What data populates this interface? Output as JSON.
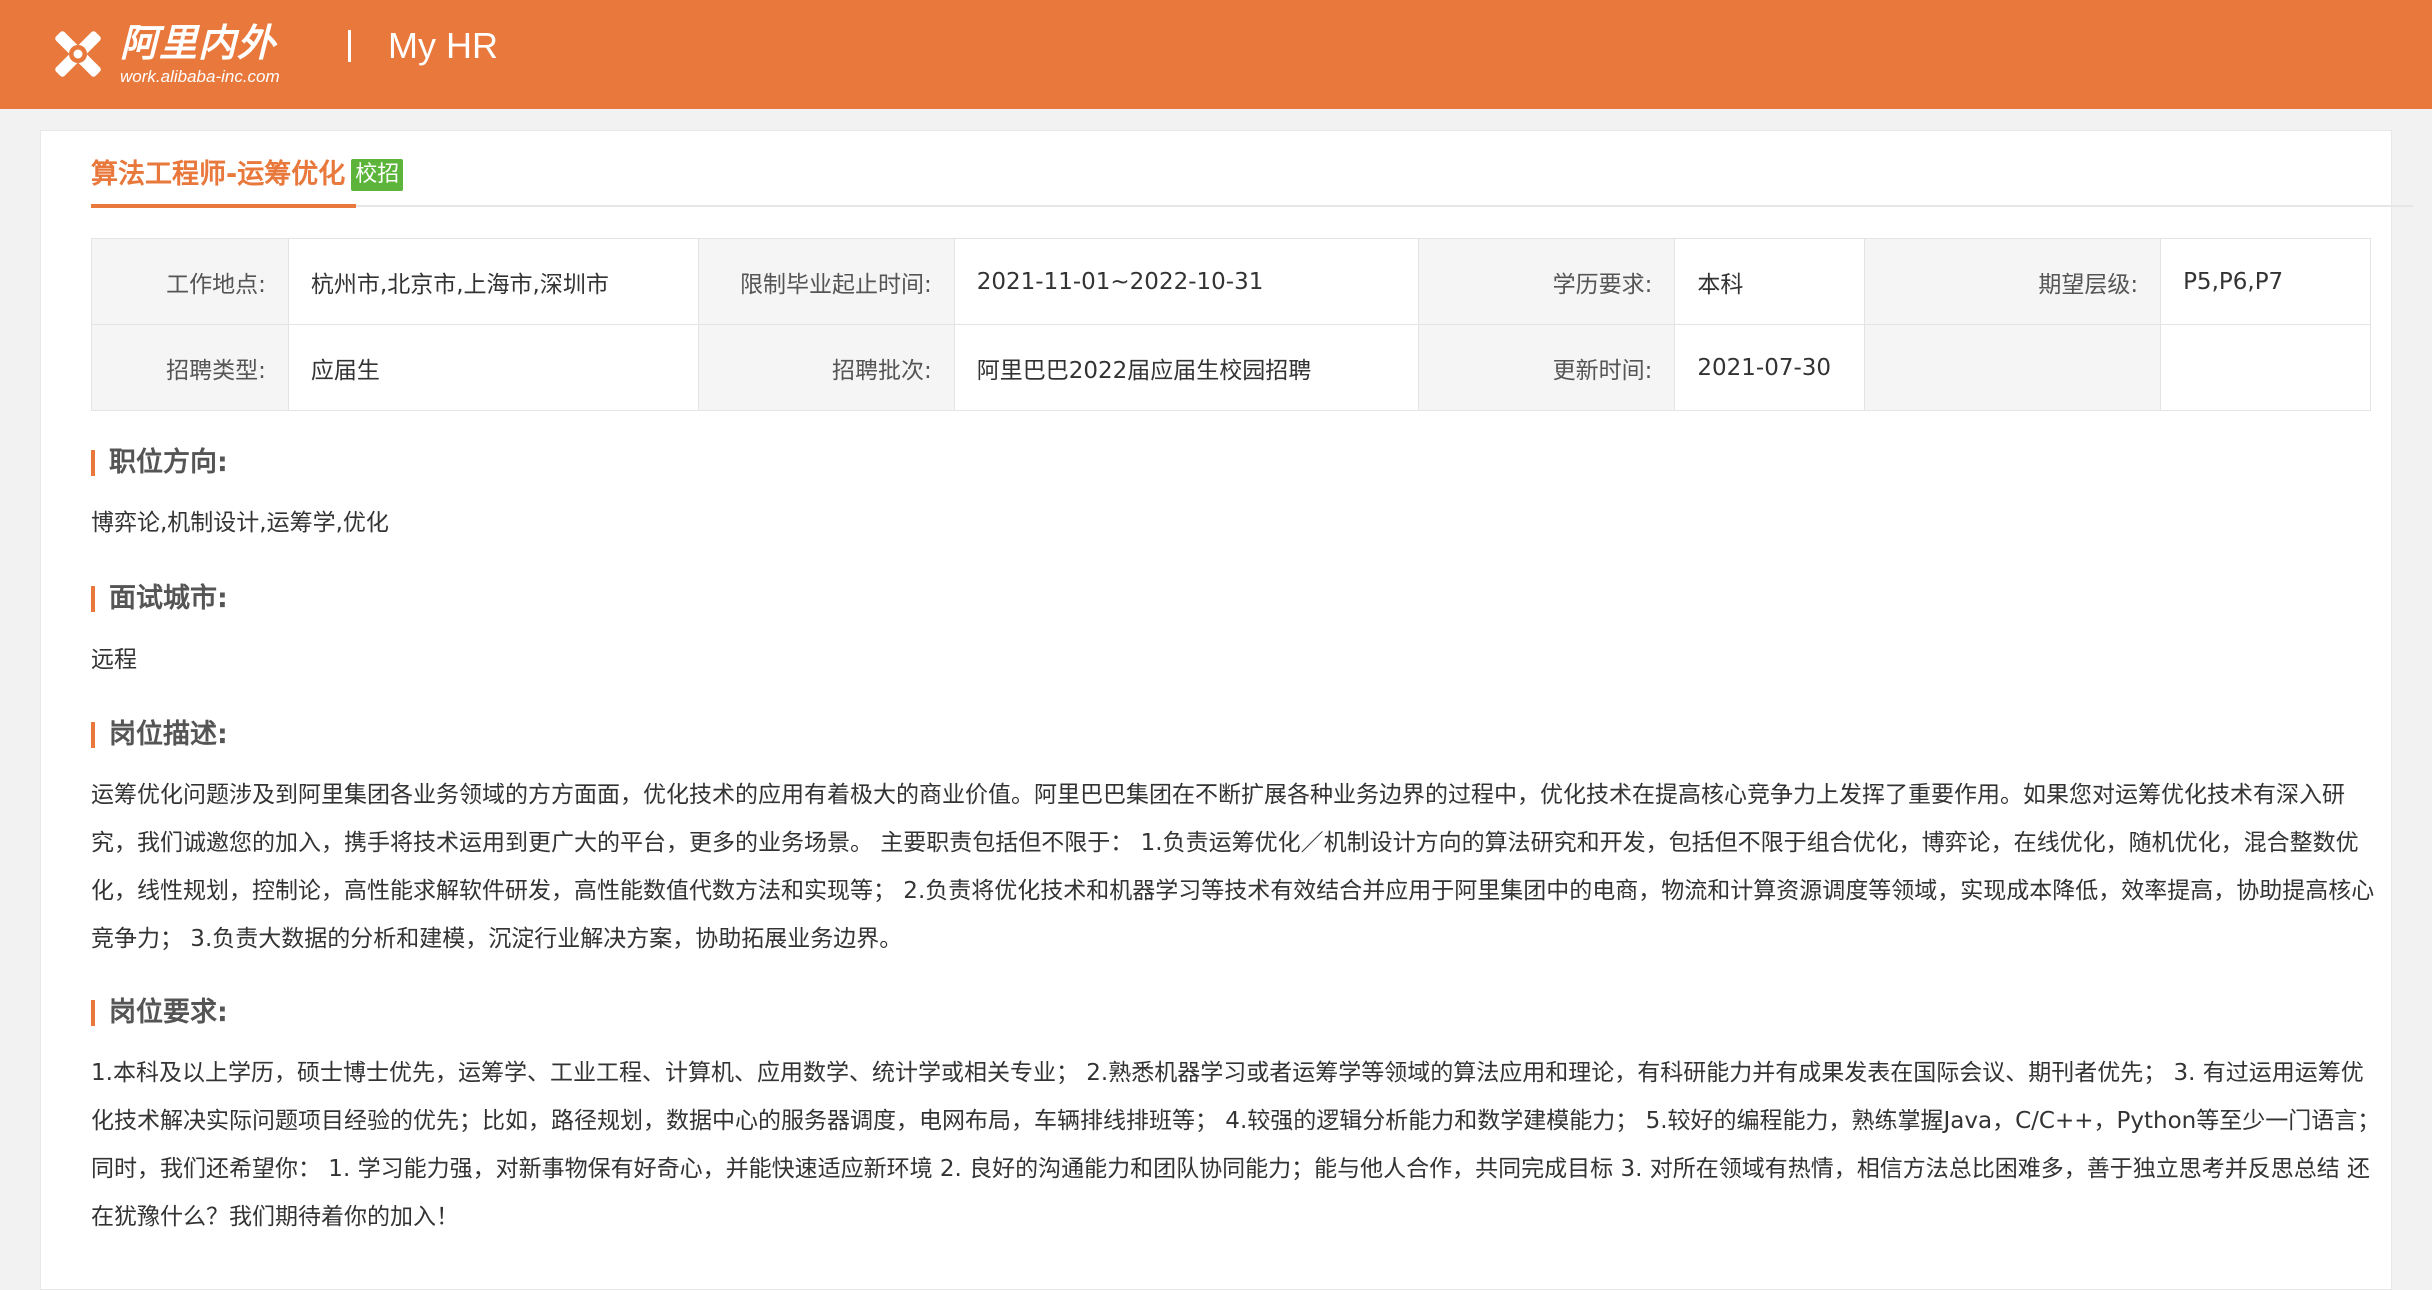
{
  "header": {
    "logo_name": "阿里内外",
    "logo_url": "work.alibaba-inc.com",
    "app_title": "My HR"
  },
  "job": {
    "title": "算法工程师-运筹优化",
    "badge": "校招"
  },
  "info": {
    "location_label": "工作地点:",
    "location_value": "杭州市,北京市,上海市,深圳市",
    "grad_period_label": "限制毕业起止时间:",
    "grad_period_value": "2021-11-01~2022-10-31",
    "education_label": "学历要求:",
    "education_value": "本科",
    "level_label": "期望层级:",
    "level_value": "P5,P6,P7",
    "type_label": "招聘类型:",
    "type_value": "应届生",
    "batch_label": "招聘批次:",
    "batch_value": "阿里巴巴2022届应届生校园招聘",
    "updated_label": "更新时间:",
    "updated_value": "2021-07-30"
  },
  "sections": {
    "direction_title": "职位方向:",
    "direction_body": "博弈论,机制设计,运筹学,优化",
    "city_title": "面试城市:",
    "city_body": "远程",
    "description_title": "岗位描述:",
    "description_body": "运筹优化问题涉及到阿里集团各业务领域的方方面面，优化技术的应用有着极大的商业价值。阿里巴巴集团在不断扩展各种业务边界的过程中，优化技术在提高核心竞争力上发挥了重要作用。如果您对运筹优化技术有深入研究，我们诚邀您的加入，携手将技术运用到更广大的平台，更多的业务场景。 主要职责包括但不限于： 1.负责运筹优化／机制设计方向的算法研究和开发，包括但不限于组合优化，博弈论，在线优化，随机优化，混合整数优化，线性规划，控制论，高性能求解软件研发，高性能数值代数方法和实现等； 2.负责将优化技术和机器学习等技术有效结合并应用于阿里集团中的电商，物流和计算资源调度等领域，实现成本降低，效率提高，协助提高核心竞争力； 3.负责大数据的分析和建模，沉淀行业解决方案，协助拓展业务边界。",
    "requirements_title": "岗位要求:",
    "requirements_body": "1.本科及以上学历，硕士博士优先，运筹学、工业工程、计算机、应用数学、统计学或相关专业； 2.熟悉机器学习或者运筹学等领域的算法应用和理论，有科研能力并有成果发表在国际会议、期刊者优先； 3. 有过运用运筹优化技术解决实际问题项目经验的优先；比如，路径规划，数据中心的服务器调度，电网布局，车辆排线排班等； 4.较强的逻辑分析能力和数学建模能力； 5.较好的编程能力，熟练掌握Java，C/C++，Python等至少一门语言； 同时，我们还希望你： 1. 学习能力强，对新事物保有好奇心，并能快速适应新环境 2. 良好的沟通能力和团队协同能力；能与他人合作，共同完成目标 3. 对所在领域有热情，相信方法总比困难多，善于独立思考并反思总结 还在犹豫什么？我们期待着你的加入！"
  }
}
